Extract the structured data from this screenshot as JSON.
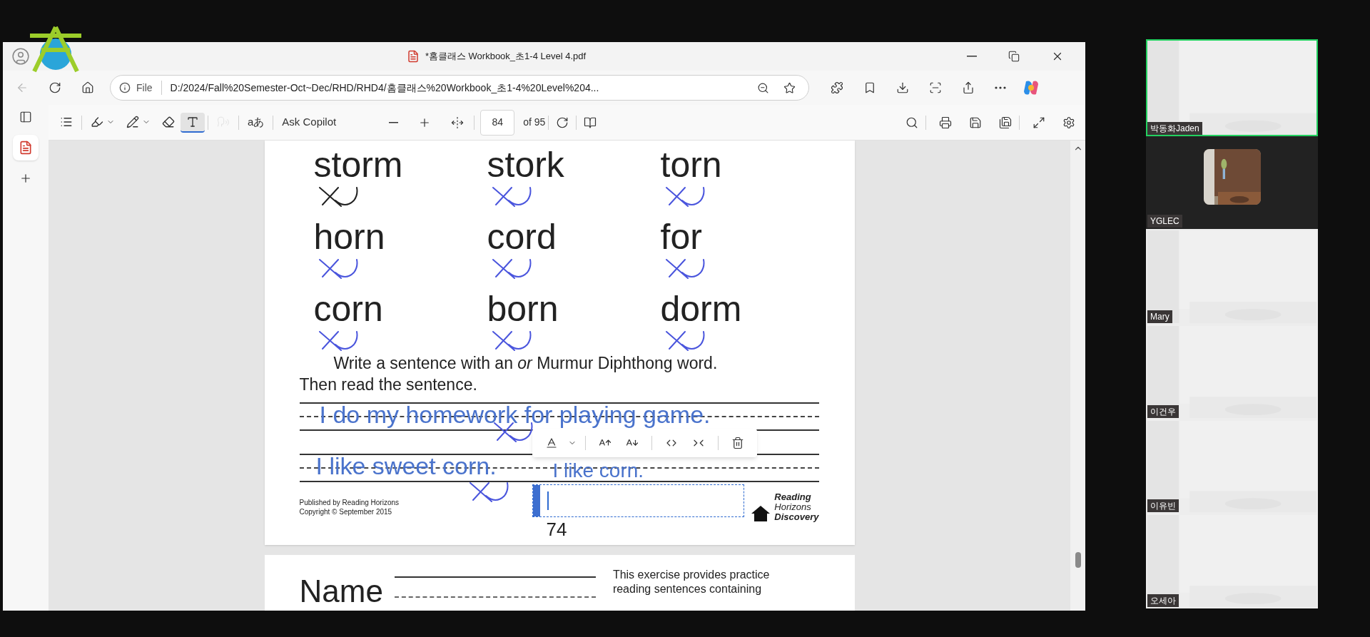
{
  "window": {
    "title": "*홈클래스 Workbook_초1-4 Level 4.pdf"
  },
  "address_bar": {
    "scheme": "File",
    "url": "D:/2024/Fall%20Semester-Oct~Dec/RHD/RHD4/홈클래스%20Workbook_초1-4%20Level%204..."
  },
  "pdf_toolbar": {
    "tools": [
      {
        "kind": "contents",
        "selected": false,
        "disabled": false
      },
      {
        "kind": "highlight",
        "selected": false,
        "disabled": false
      },
      {
        "kind": "draw",
        "selected": false,
        "disabled": false
      },
      {
        "kind": "erase",
        "selected": false,
        "disabled": false
      },
      {
        "kind": "text",
        "selected": true,
        "disabled": false
      },
      {
        "kind": "read_aloud",
        "selected": false,
        "disabled": true
      }
    ],
    "translate_label": "aあ",
    "copilot_label": "Ask Copilot",
    "page_number": "84",
    "page_count": "of 95"
  },
  "sidebar": {
    "tabs": [
      {
        "selected": true
      }
    ]
  },
  "page": {
    "words": [
      {
        "text": "storm",
        "color": "#222222"
      },
      {
        "text": "stork",
        "color": "#4a55dd"
      },
      {
        "text": "torn",
        "color": "#4a55dd"
      },
      {
        "text": "horn",
        "color": "#4a55dd"
      },
      {
        "text": "cord",
        "color": "#4a55dd"
      },
      {
        "text": "for",
        "color": "#4a55dd"
      },
      {
        "text": "corn",
        "color": "#4a55dd"
      },
      {
        "text": "born",
        "color": "#4a55dd"
      },
      {
        "text": "dorm",
        "color": "#4a55dd"
      }
    ],
    "instruction": "Write a sentence with an *or* Murmur Diphthong word.",
    "instruction_2": "Then read the sentence.",
    "typed_texts": [
      "I do my homework for playing game.",
      "I like sweet corn.",
      "I like corn."
    ],
    "footer": [
      "Published by Reading Horizons",
      "Copyright © September 2015"
    ],
    "logo_lines": [
      "Reading",
      "Horizons",
      "Discovery"
    ],
    "page_number": "74"
  },
  "next_page": {
    "name_label": "Name",
    "description": [
      "This exercise provides practice",
      "reading sentences containing"
    ]
  },
  "participants": [
    {
      "name": "박동화Jaden",
      "kind": "video",
      "speaking": true
    },
    {
      "name": "YGLEC",
      "kind": "avatar",
      "speaking": false
    },
    {
      "name": "Mary",
      "kind": "video",
      "speaking": false
    },
    {
      "name": "이건우",
      "kind": "video",
      "speaking": false
    },
    {
      "name": "이유빈",
      "kind": "video",
      "speaking": false
    },
    {
      "name": "오세아",
      "kind": "video",
      "speaking": false
    }
  ]
}
